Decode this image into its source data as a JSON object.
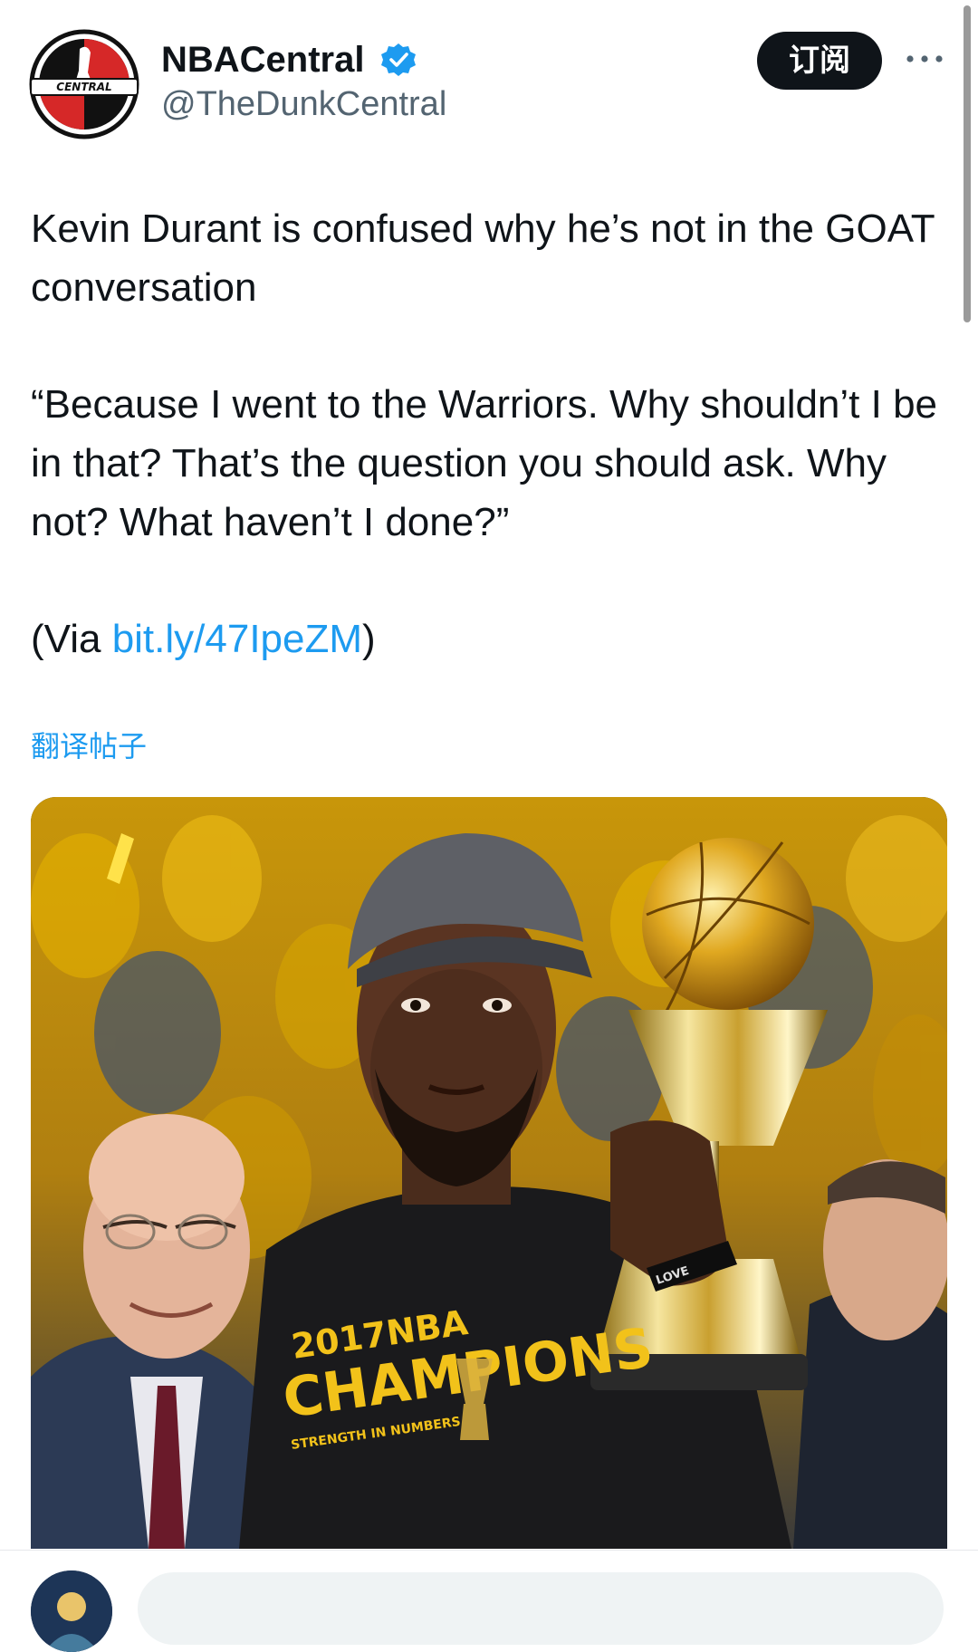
{
  "tweet": {
    "author": {
      "display_name": "NBACentral",
      "handle": "@TheDunkCentral",
      "verified": true,
      "avatar_logo_text": "CENTRAL",
      "avatar_icon": "basketball-logo-icon",
      "verified_icon": "verified-check-icon"
    },
    "header_actions": {
      "subscribe_label": "订阅",
      "more_icon": "more-horizontal-icon"
    },
    "text": {
      "line1": "Kevin Durant is confused why he’s not in the GOAT conversation",
      "quote": "“Because I went to the Warriors. Why shouldn’t I be in that? That’s the question you should ask. Why not? What haven’t I done?”",
      "via_prefix": "(Via ",
      "via_link": "bit.ly/47IpeZM",
      "via_suffix": ")"
    },
    "translate_label": "翻译帖子",
    "media": {
      "shirt_text_year_brand": "2017NBA",
      "shirt_text_title": "CHAMPIONS",
      "shirt_sub": "STRENGTH IN NUMBERS",
      "wristband_text": "LOVE"
    }
  },
  "reply_bar": {
    "avatar_icon": "user-avatar-icon"
  },
  "colors": {
    "link": "#1d9bf0",
    "text": "#0f1419",
    "secondary_text": "#536471",
    "subscribe_bg": "#0f1419",
    "warriors_yellow": "#f2b500",
    "warriors_blue": "#1d428a"
  }
}
